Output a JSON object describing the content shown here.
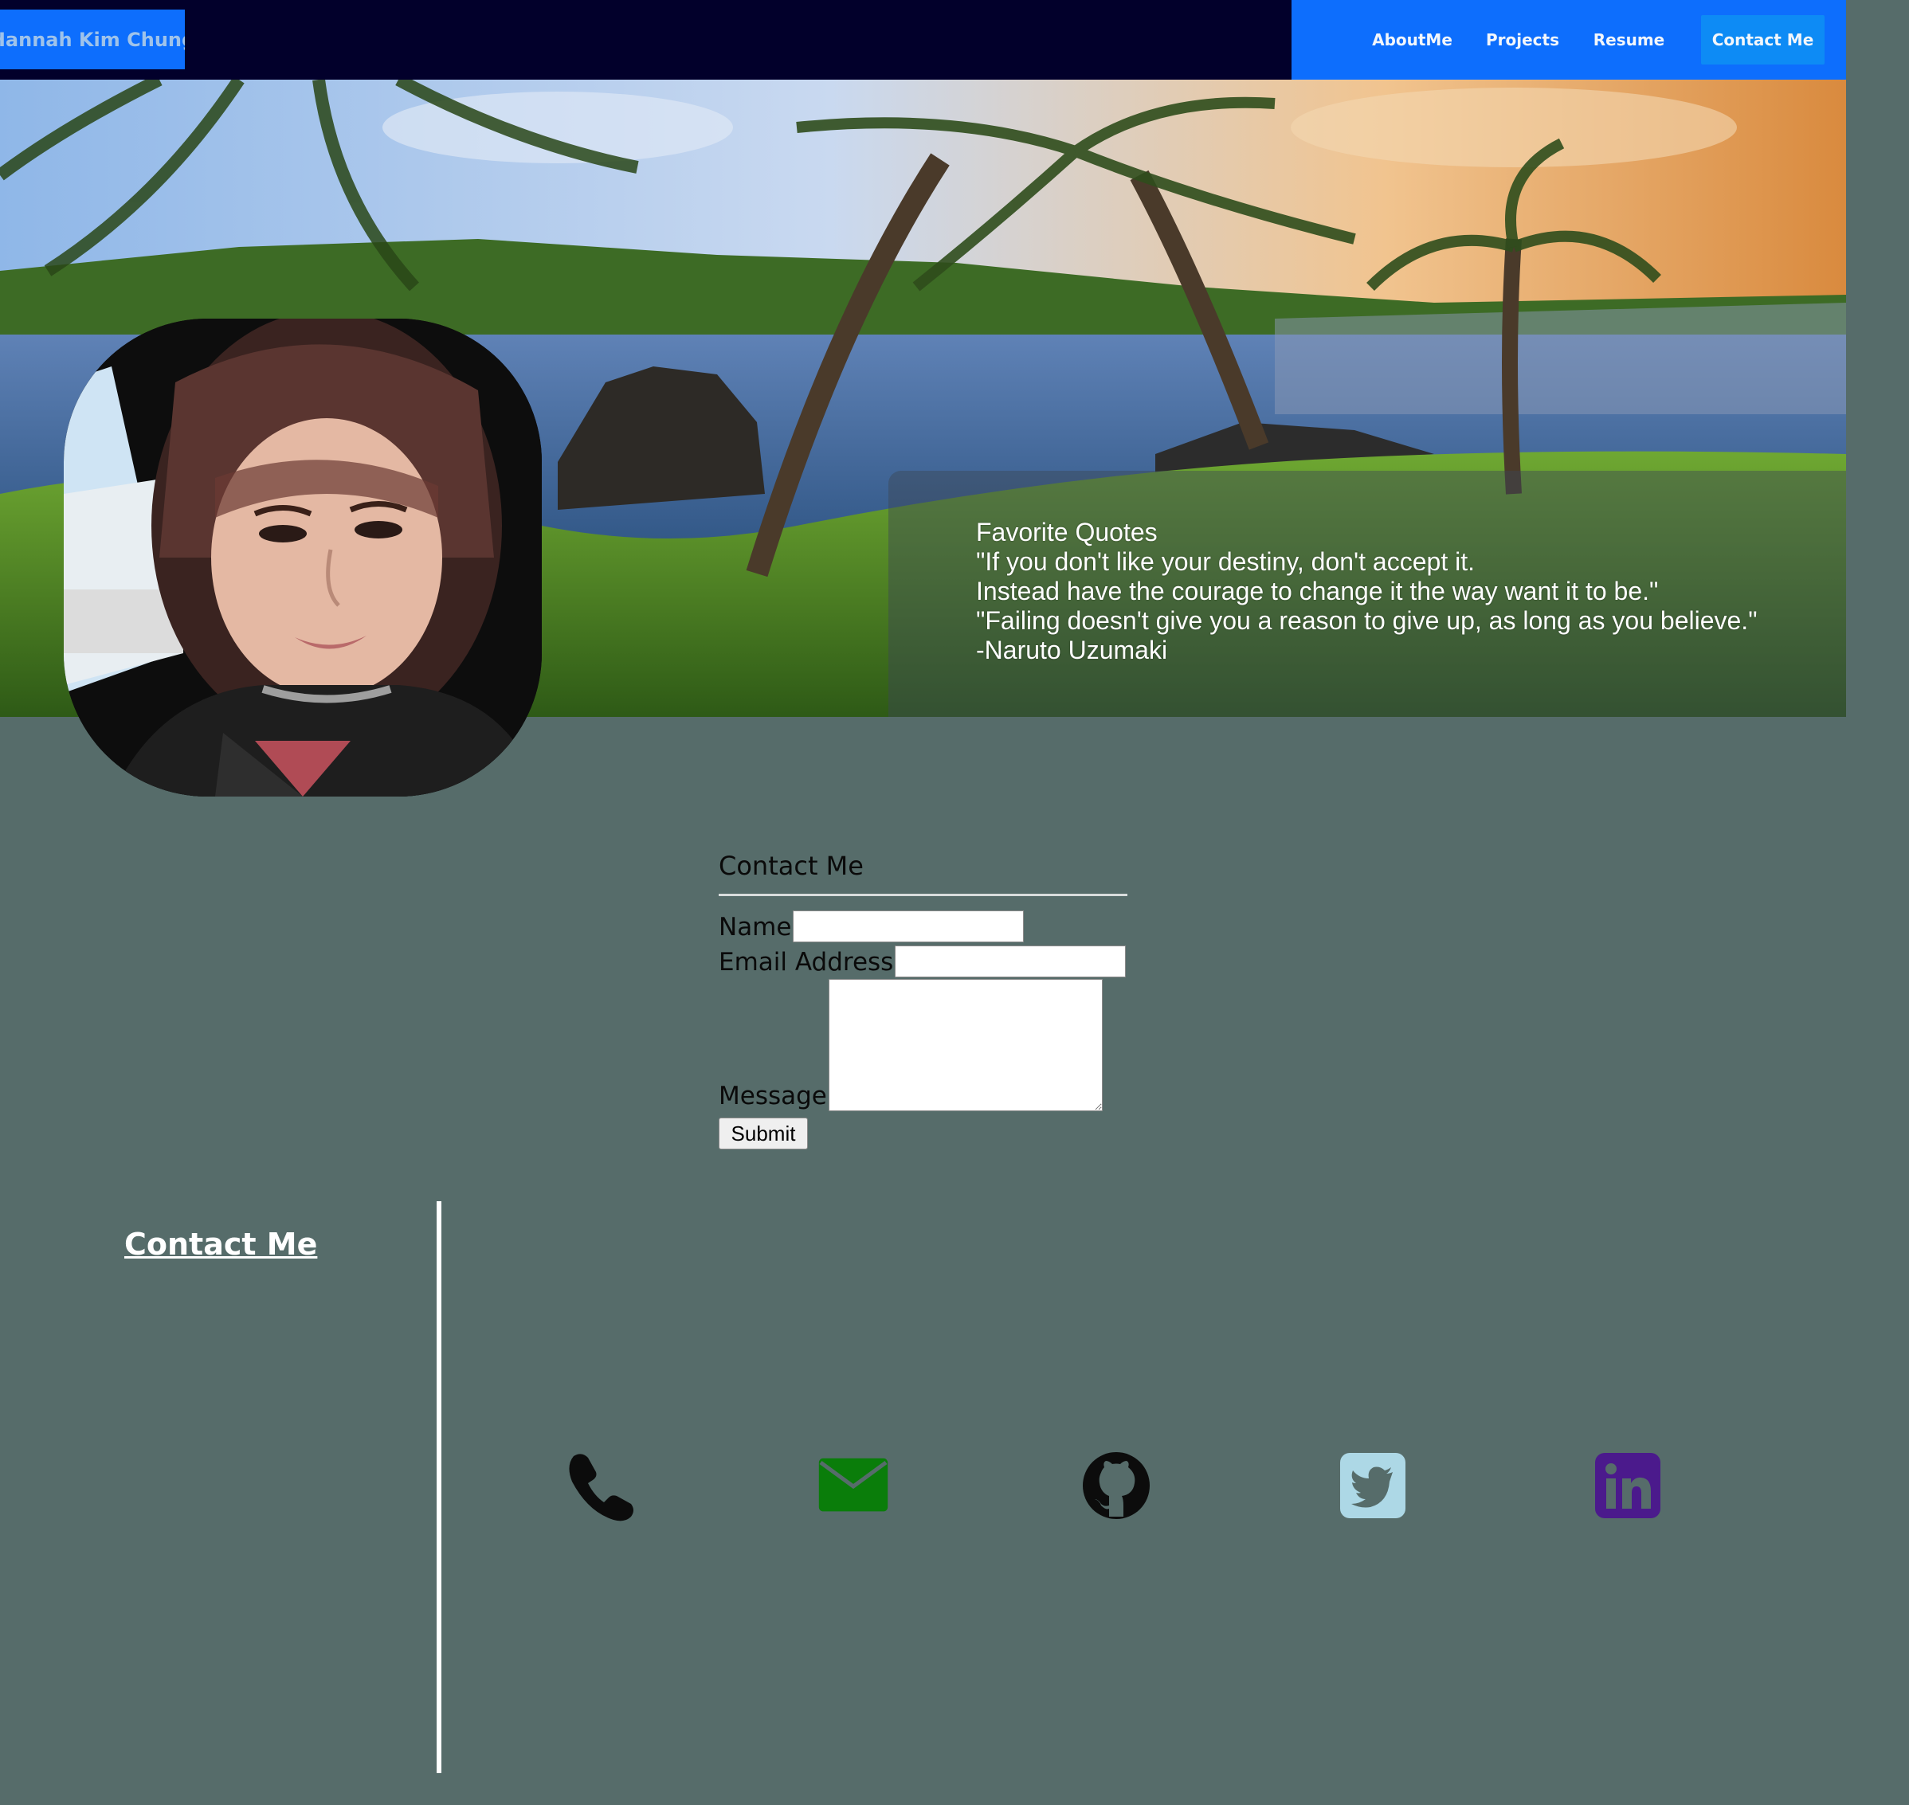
{
  "nav": {
    "brand": "Hannah Kim Chung",
    "links": [
      "AboutMe",
      "Projects",
      "Resume",
      "Contact Me"
    ]
  },
  "hero": {
    "quotes": [
      "Favorite Quotes",
      "\"If you don't like your destiny, don't accept it.",
      "Instead have the courage to change it the way want it to be.\"",
      "\"Failing doesn't give you a reason to give up, as long as you believe.\"",
      "-Naruto Uzumaki"
    ]
  },
  "form": {
    "title": "Contact Me",
    "name_label": "Name",
    "email_label": "Email Address",
    "message_label": "Message",
    "submit_label": "Submit"
  },
  "footer": {
    "title": "Contact Me",
    "icons": [
      "phone-icon",
      "mail-icon",
      "github-icon",
      "twitter-icon",
      "linkedin-icon"
    ]
  },
  "colors": {
    "background": "#566c6a",
    "navbar": "#02002b",
    "accent": "#0d6efd",
    "mail_icon": "#0a7d0a",
    "twitter_icon": "#add8e6",
    "linkedin_icon": "#4b1a8c"
  }
}
